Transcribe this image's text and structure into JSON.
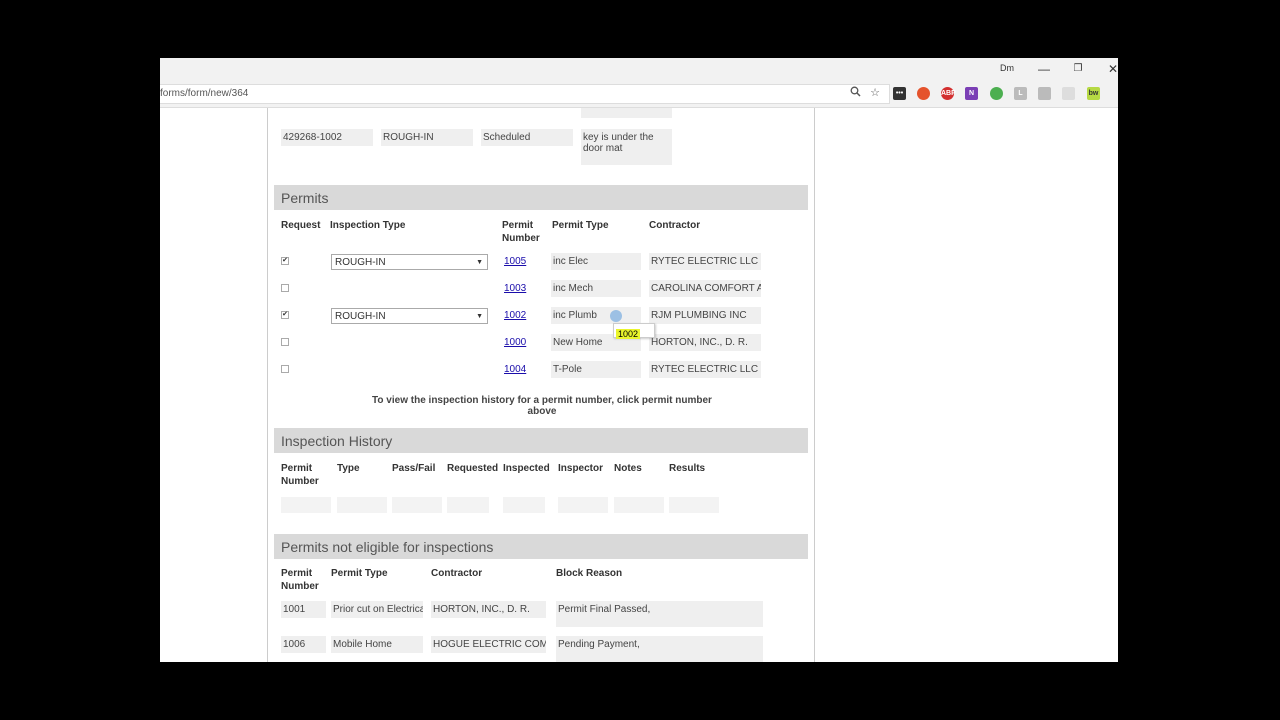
{
  "browser": {
    "user": "Dm",
    "url": "forms/form/new/364",
    "controls": {
      "minimize": "—",
      "restore": "❐",
      "close": "✕"
    }
  },
  "top_row": {
    "permit": "429268-1002",
    "type": "ROUGH-IN",
    "status": "Scheduled",
    "note": "key is under the door mat"
  },
  "permits_section": {
    "title": "Permits",
    "headers": {
      "request": "Request",
      "inspection_type": "Inspection Type",
      "permit_number_1": "Permit",
      "permit_number_2": "Number",
      "permit_type": "Permit Type",
      "contractor": "Contractor"
    },
    "rows": [
      {
        "checked": "✔",
        "inspection_type": "ROUGH-IN",
        "number": "1005",
        "permit_type": "inc Elec",
        "contractor": "RYTEC ELECTRIC LLC"
      },
      {
        "checked": "",
        "inspection_type": "",
        "number": "1003",
        "permit_type": "inc Mech",
        "contractor": "CAROLINA COMFORT A"
      },
      {
        "checked": "✔",
        "inspection_type": "ROUGH-IN",
        "number": "1002",
        "permit_type": "inc Plumb",
        "contractor": "RJM PLUMBING INC"
      },
      {
        "checked": "",
        "inspection_type": "",
        "number": "1000",
        "permit_type": "New Home",
        "contractor": "HORTON, INC., D. R."
      },
      {
        "checked": "",
        "inspection_type": "",
        "number": "1004",
        "permit_type": "T-Pole",
        "contractor": "RYTEC ELECTRIC LLC"
      }
    ],
    "tooltip": "1002",
    "note": "To view the inspection history for a permit number, click permit number above"
  },
  "history_section": {
    "title": "Inspection History",
    "headers": {
      "permit_1": "Permit",
      "permit_2": "Number",
      "type": "Type",
      "pass_fail": "Pass/Fail",
      "requested": "Requested",
      "inspected": "Inspected",
      "inspector": "Inspector",
      "notes": "Notes",
      "results": "Results"
    }
  },
  "ineligible_section": {
    "title": "Permits not eligible for inspections",
    "headers": {
      "permit_1": "Permit",
      "permit_2": "Number",
      "permit_type": "Permit Type",
      "contractor": "Contractor",
      "block_reason": "Block Reason"
    },
    "rows": [
      {
        "number": "1001",
        "permit_type": "Prior cut on Electrica",
        "contractor": "HORTON, INC., D. R.",
        "reason": "Permit Final Passed,"
      },
      {
        "number": "1006",
        "permit_type": "Mobile Home",
        "contractor": "HOGUE ELECTRIC COMI",
        "reason": "Pending Payment,"
      }
    ]
  }
}
